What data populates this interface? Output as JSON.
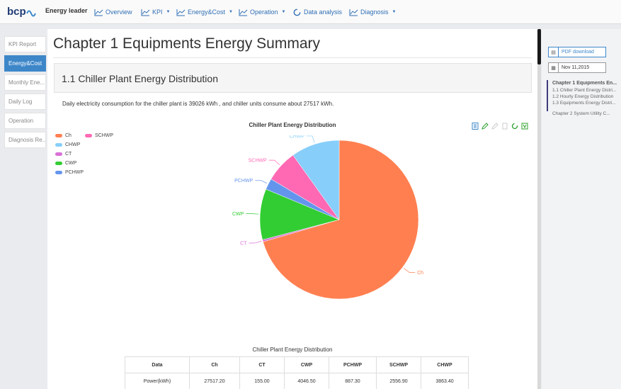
{
  "header": {
    "brand": "Energy leader",
    "nav": [
      {
        "label": "Overview",
        "icon": "line-chart-icon",
        "dropdown": false
      },
      {
        "label": "KPI",
        "icon": "line-chart-icon",
        "dropdown": true
      },
      {
        "label": "Energy&Cost",
        "icon": "line-chart-icon",
        "dropdown": true
      },
      {
        "label": "Operation",
        "icon": "line-chart-icon",
        "dropdown": true
      },
      {
        "label": "Data analysis",
        "icon": "refresh-icon",
        "dropdown": false
      },
      {
        "label": "Diagnosis",
        "icon": "line-chart-icon",
        "dropdown": true
      }
    ]
  },
  "sidebar": {
    "items": [
      {
        "label": "KPI Report",
        "active": false
      },
      {
        "label": "Energy&Cost",
        "active": true
      },
      {
        "label": "Monthly Ene...",
        "active": false
      },
      {
        "label": "Daily Log",
        "active": false
      },
      {
        "label": "Operation",
        "active": false
      },
      {
        "label": "Diagnosis Re...",
        "active": false
      }
    ]
  },
  "main": {
    "chapter_title": "Chapter 1 Equipments Energy Summary",
    "section_title": "1.1 Chiller Plant Energy Distribution",
    "summary": "Daily electricity consumption for the chiller plant is 39026 kWh , and chiller units consume about 27517 kWh.",
    "table": {
      "caption": "Chiller Plant Energy Distribution",
      "headers": [
        "Data",
        "Ch",
        "CT",
        "CWP",
        "PCHWP",
        "SCHWP",
        "CHWP"
      ],
      "row": [
        "Power(kWh)",
        "27517.20",
        "155.00",
        "4046.50",
        "887.30",
        "2556.90",
        "3863.40"
      ]
    }
  },
  "chart_data": {
    "type": "pie",
    "title": "Chiller Plant Energy Distribution",
    "legend_position": "top-left",
    "categories": [
      "Ch",
      "CT",
      "CWP",
      "PCHWP",
      "SCHWP",
      "CHWP"
    ],
    "values": [
      27517.2,
      155.0,
      4046.5,
      887.3,
      2556.9,
      3863.4
    ],
    "colors": [
      "#ff7f50",
      "#da70d6",
      "#32cd32",
      "#6495ed",
      "#ff69b4",
      "#87cefa"
    ]
  },
  "right_panel": {
    "pdf_label": "PDF download",
    "date": "Nov 11,2015",
    "toc": {
      "chapter1": "Chapter 1 Equipments En...",
      "items": [
        "1.1 Chiller Plant Energy Distri...",
        "1.2 Hourly Energy Distribution",
        "1.3 Equipments Energy Distri..."
      ],
      "chapter2": "Chapter 2 System Utility C..."
    }
  }
}
